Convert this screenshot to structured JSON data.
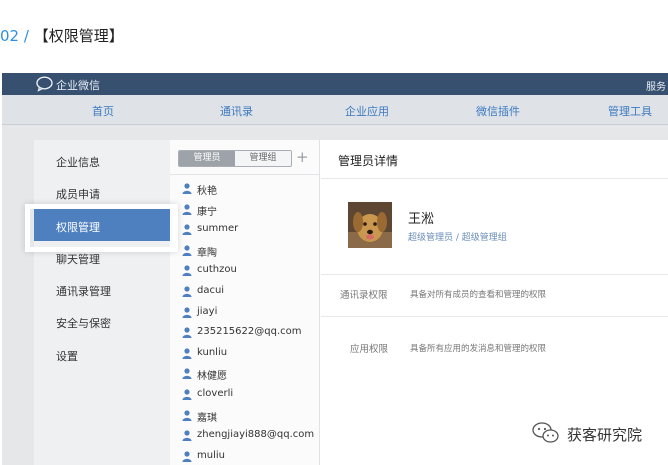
{
  "heading": {
    "number": "02 / ",
    "title": "【权限管理】"
  },
  "topbar": {
    "brand": "企业微信",
    "service": "服务"
  },
  "nav": [
    "首页",
    "通讯录",
    "企业应用",
    "微信插件",
    "管理工具"
  ],
  "menu": [
    "企业信息",
    "成员申请",
    "权限管理",
    "聊天管理",
    "通讯录管理",
    "安全与保密",
    "设置"
  ],
  "menu_active": "权限管理",
  "admin_tabs": {
    "admins": "管理员",
    "groups": "管理组",
    "add": "+"
  },
  "admins": [
    "秋艳",
    "康宁",
    "summer",
    "章陶",
    "cuthzou",
    "dacui",
    "jiayi",
    "235215622@qq.com",
    "kunliu",
    "林健愿",
    "cloverli",
    "嘉琪",
    "zhengjiayi888@qq.com",
    "muliu"
  ],
  "detail": {
    "title": "管理员详情",
    "name": "王淞",
    "role": "超级管理员 / 超级管理组",
    "contacts_label": "通讯录权限",
    "contacts_desc": "具备对所有成员的查看和管理的权限",
    "apps_label": "应用权限",
    "apps_desc": "具备所有应用的发消息和管理的权限"
  },
  "watermark": "获客研究院",
  "colors": {
    "topbar": "#37506f",
    "nav_link": "#3b79bf",
    "active_menu": "#4e7fbf",
    "heading_number": "#2f8fe0"
  },
  "icons": {
    "logo": "chat-bubble-icon",
    "admin": "person-icon",
    "watermark": "wechat-logo-icon"
  }
}
